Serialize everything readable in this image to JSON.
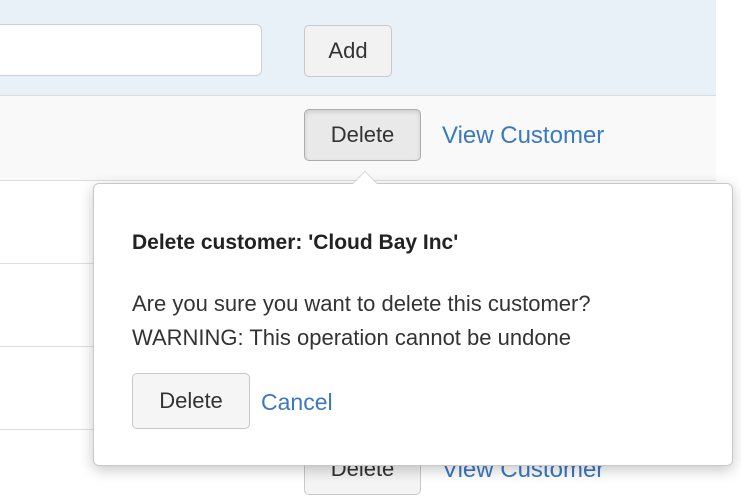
{
  "add_row": {
    "input_value": "",
    "add_label": "Add"
  },
  "rows": [
    {
      "delete_label": "Delete",
      "view_label": "View Customer"
    },
    {
      "delete_label": "Delete",
      "view_label": "View Customer"
    }
  ],
  "popover": {
    "title": "Delete customer: 'Cloud Bay Inc'",
    "message_line1": "Are you sure you want to delete this customer?",
    "message_line2": "WARNING: This operation cannot be undone",
    "confirm_label": "Delete",
    "cancel_label": "Cancel"
  },
  "colors": {
    "link": "#3a78c2",
    "header_bg": "#e8f0f8"
  }
}
